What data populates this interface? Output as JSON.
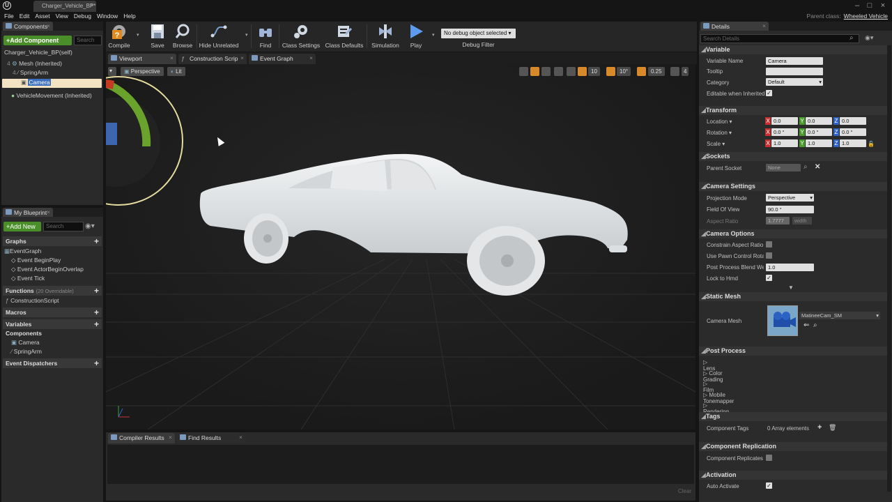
{
  "window": {
    "doc_tab": "Charger_Vehicle_BP*",
    "parent_class_label": "Parent class:",
    "parent_class_value": "Wheeled Vehicle"
  },
  "menu": [
    "File",
    "Edit",
    "Asset",
    "View",
    "Debug",
    "Window",
    "Help"
  ],
  "components_panel": {
    "tab": "Components",
    "add_button": "+Add Component",
    "search_placeholder": "Search",
    "self_row": "Charger_Vehicle_BP(self)",
    "tree": [
      {
        "label": "Mesh (Inherited)",
        "depth": 1
      },
      {
        "label": "SpringArm",
        "depth": 2
      },
      {
        "label": "Camera",
        "depth": 3,
        "selected": true
      },
      {
        "label": "VehicleMovement (Inherited)",
        "depth": 1
      }
    ]
  },
  "toolbar": {
    "compile": "Compile",
    "save": "Save",
    "browse": "Browse",
    "hide_unrelated": "Hide Unrelated",
    "find": "Find",
    "class_settings": "Class Settings",
    "class_defaults": "Class Defaults",
    "simulation": "Simulation",
    "play": "Play",
    "debug_select": "No debug object selected",
    "debug_filter": "Debug Filter"
  },
  "editor_tabs": [
    "Viewport",
    "Construction Scrip",
    "Event Graph"
  ],
  "viewport": {
    "perspective": "Perspective",
    "lit": "Lit",
    "grid_snap": "10",
    "rot_snap": "10°",
    "scale_snap": "0.25",
    "cam_speed": "4"
  },
  "blueprint_panel": {
    "tab": "My Blueprint",
    "add_new": "+Add New",
    "search_placeholder": "Search",
    "graphs_label": "Graphs",
    "event_graph": "EventGraph",
    "events": [
      "Event BeginPlay",
      "Event ActorBeginOverlap",
      "Event Tick"
    ],
    "functions_label": "Functions",
    "functions_sub": "(20 Overridable)",
    "construction_script": "ConstructionScript",
    "macros_label": "Macros",
    "variables_label": "Variables",
    "components_label": "Components",
    "components": [
      "Camera",
      "SpringArm"
    ],
    "dispatchers_label": "Event Dispatchers"
  },
  "bottom_panel": {
    "tabs": [
      "Compiler Results",
      "Find Results"
    ],
    "clear": "Clear"
  },
  "details": {
    "tab": "Details",
    "search_placeholder": "Search Details",
    "variable": {
      "title": "Variable",
      "name_label": "Variable Name",
      "name_value": "Camera",
      "tooltip_label": "Tooltip",
      "category_label": "Category",
      "category_value": "Default",
      "editable_label": "Editable when Inherited"
    },
    "transform": {
      "title": "Transform",
      "location": "Location",
      "rotation": "Rotation",
      "scale": "Scale",
      "loc": [
        "0.0",
        "0.0",
        "0.0"
      ],
      "rot": [
        "0.0 °",
        "0.0 °",
        "0.0 °"
      ],
      "scl": [
        "1.0",
        "1.0",
        "1.0"
      ]
    },
    "sockets": {
      "title": "Sockets",
      "parent_socket_label": "Parent Socket",
      "parent_socket_value": "None"
    },
    "camera_settings": {
      "title": "Camera Settings",
      "projection_label": "Projection Mode",
      "projection_value": "Perspective",
      "fov_label": "Field Of View",
      "fov_value": "90.0 °",
      "aspect_label": "Aspect Ratio",
      "aspect_value": "1.7777",
      "aspect_unit": "width"
    },
    "camera_options": {
      "title": "Camera Options",
      "constrain": "Constrain Aspect Ratio",
      "pawn_control": "Use Pawn Control Rotati",
      "blend_label": "Post Process Blend Wei",
      "blend_value": "1.0",
      "lock_hmd": "Lock to Hmd"
    },
    "static_mesh": {
      "title": "Static Mesh",
      "camera_mesh_label": "Camera Mesh",
      "mesh_value": "MatineeCam_SM"
    },
    "post_process": {
      "title": "Post Process",
      "items": [
        "Lens",
        "Color Grading",
        "Film",
        "Mobile Tonemapper",
        "Rendering Features"
      ]
    },
    "tags": {
      "title": "Tags",
      "component_tags_label": "Component Tags",
      "component_tags_value": "0 Array elements"
    },
    "replication": {
      "title": "Component Replication",
      "label": "Component Replicates"
    },
    "activation": {
      "title": "Activation",
      "label": "Auto Activate"
    }
  },
  "colors": {
    "accent_green": "#4a8e2a",
    "play_blue": "#3d7ed8",
    "selection": "#f5e6c8"
  }
}
